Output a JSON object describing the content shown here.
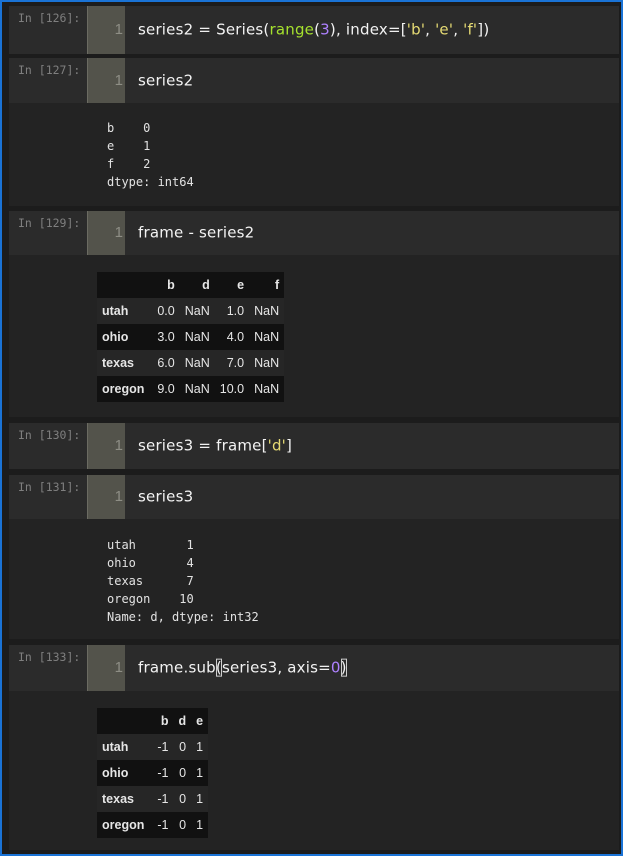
{
  "cells": {
    "c126": {
      "prompt": "In [126]:",
      "line": "1"
    },
    "c127": {
      "prompt": "In [127]:",
      "line": "1",
      "code": "series2",
      "output": "b    0\ne    1\nf    2\ndtype: int64"
    },
    "c129": {
      "prompt": "In [129]:",
      "line": "1",
      "code": "frame - series2",
      "table": {
        "columns": [
          "",
          "b",
          "d",
          "e",
          "f"
        ],
        "rows": [
          [
            "utah",
            "0.0",
            "NaN",
            "1.0",
            "NaN"
          ],
          [
            "ohio",
            "3.0",
            "NaN",
            "4.0",
            "NaN"
          ],
          [
            "texas",
            "6.0",
            "NaN",
            "7.0",
            "NaN"
          ],
          [
            "oregon",
            "9.0",
            "NaN",
            "10.0",
            "NaN"
          ]
        ]
      }
    },
    "c130": {
      "prompt": "In [130]:",
      "line": "1"
    },
    "c131": {
      "prompt": "In [131]:",
      "line": "1",
      "code": "series3",
      "output": "utah       1\nohio       4\ntexas      7\noregon    10\nName: d, dtype: int32"
    },
    "c133": {
      "prompt": "In [133]:",
      "line": "1",
      "table": {
        "columns": [
          "",
          "b",
          "d",
          "e"
        ],
        "rows": [
          [
            "utah",
            "-1",
            "0",
            "1"
          ],
          [
            "ohio",
            "-1",
            "0",
            "1"
          ],
          [
            "texas",
            "-1",
            "0",
            "1"
          ],
          [
            "oregon",
            "-1",
            "0",
            "1"
          ]
        ]
      }
    }
  },
  "tokens": {
    "t126": [
      "series2 ",
      "=",
      " Series(",
      "range",
      "(",
      "3",
      "), index",
      "=",
      "[",
      "'b'",
      ", ",
      "'e'",
      ", ",
      "'f'",
      "])"
    ],
    "t130": [
      "series3 ",
      "=",
      " frame[",
      "'d'",
      "]"
    ],
    "t133": [
      "frame.sub",
      "(",
      "series3, axis",
      "=",
      "0",
      ")"
    ]
  },
  "colors": {
    "border": "#1a73d6",
    "function": "#a6e22e",
    "number": "#ae81ff",
    "string": "#e6db74",
    "gutter": "#53534b"
  }
}
